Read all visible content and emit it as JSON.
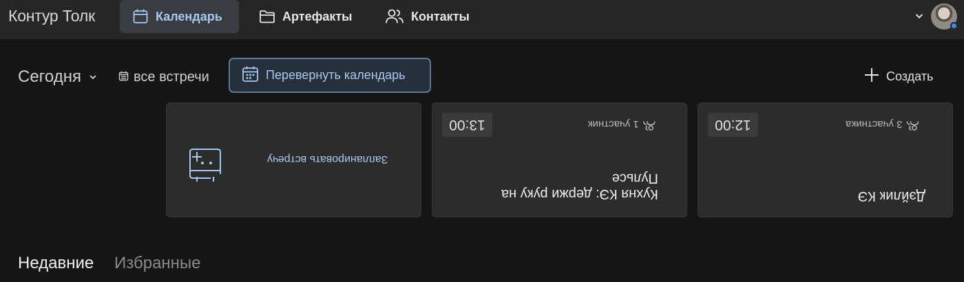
{
  "app": {
    "title": "Контур Толк"
  },
  "nav": {
    "calendar_label": "Календарь",
    "artifacts_label": "Артефакты",
    "contacts_label": "Контакты"
  },
  "toolbar": {
    "today_label": "Сегодня",
    "all_meetings_label": "все встречи",
    "flip_calendar_label": "Перевернуть календарь",
    "create_label": "Создать"
  },
  "cards": {
    "schedule": {
      "label": "Запланировать встречу"
    },
    "kitchen": {
      "title_line1": "Кухня КЭ: держи руку на",
      "title_line2": "Пульсе",
      "participants": "1 участник",
      "time": "13:00"
    },
    "daily": {
      "title": "Дэйлик КЭ",
      "participants": "3 участника",
      "time": "12:00"
    }
  },
  "bottom_tabs": {
    "recent_label": "Недавние",
    "favorites_label": "Избранные"
  },
  "colors": {
    "accent": "#a8c9f2",
    "background": "#151515",
    "card": "#2c2c2c",
    "status_dot": "#3e8ef0"
  }
}
